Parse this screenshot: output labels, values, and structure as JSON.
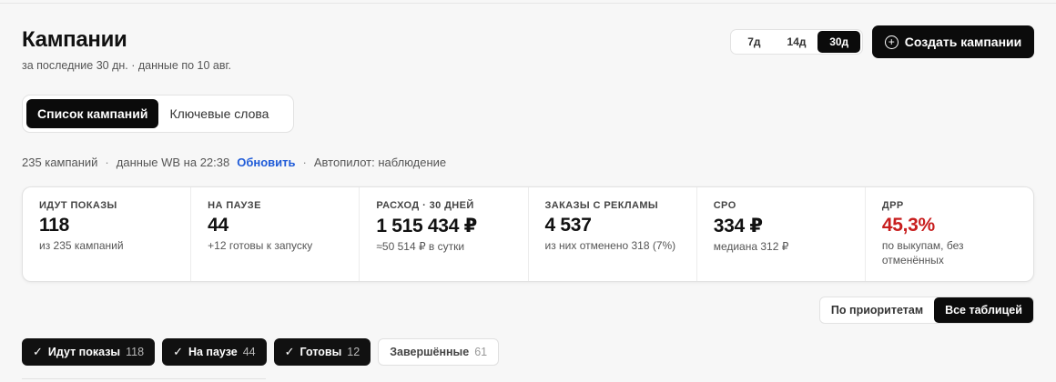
{
  "header": {
    "title": "Кампании",
    "subtitle": "за последние 30 дн. · данные по 10 авг."
  },
  "period": {
    "options": [
      "7д",
      "14д",
      "30д"
    ],
    "selected": "30д"
  },
  "create_button": {
    "label": "Создать кампании"
  },
  "tabs": [
    {
      "label": "Список кампаний",
      "active": true
    },
    {
      "label": "Ключевые слова",
      "active": false
    }
  ],
  "info": {
    "count": "235 кампаний",
    "data_time": "данные WB на 22:38",
    "refresh": "Обновить",
    "autopilot": "Автопилот: наблюдение"
  },
  "stats": [
    {
      "label": "ИДУТ ПОКАЗЫ",
      "value": "118",
      "sub": "из 235 кампаний"
    },
    {
      "label": "НА ПАУЗЕ",
      "value": "44",
      "sub": "+12 готовы к запуску"
    },
    {
      "label": "РАСХОД · 30 ДНЕЙ",
      "value": "1 515 434 ₽",
      "sub": "≈50 514 ₽ в сутки"
    },
    {
      "label": "ЗАКАЗЫ С РЕКЛАМЫ",
      "value": "4 537",
      "sub": "из них отменено 318 (7%)"
    },
    {
      "label": "CPO",
      "value": "334 ₽",
      "sub": "медиана 312 ₽"
    },
    {
      "label": "ДРР",
      "value": "45,3%",
      "sub": "по выкупам, без отменённых"
    }
  ],
  "view_toggle": {
    "by_priority": "По приоритетам",
    "table": "Все таблицей"
  },
  "chips": [
    {
      "label": "Идут показы",
      "count": "118",
      "on": true
    },
    {
      "label": "На паузе",
      "count": "44",
      "on": true
    },
    {
      "label": "Готовы",
      "count": "12",
      "on": true
    },
    {
      "label": "Завершённые",
      "count": "61",
      "on": false
    }
  ],
  "colors": {
    "accent_dark": "#0b0b0b",
    "link": "#1f5bd8",
    "danger": "#c81e1e"
  }
}
